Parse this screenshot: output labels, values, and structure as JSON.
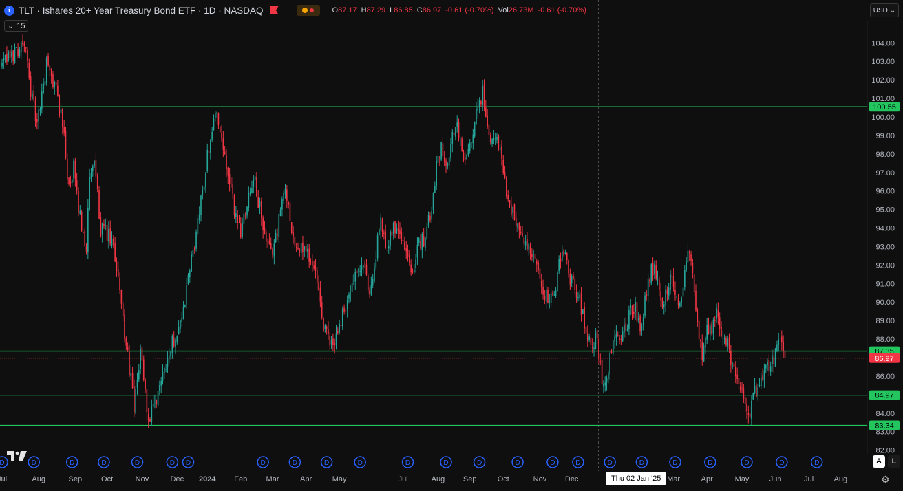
{
  "header": {
    "info_glyph": "i",
    "title": "TLT · Ishares 20+ Year Treasury Bond ETF · 1D · NASDAQ",
    "ohlc": [
      {
        "k": "O",
        "v": "87.17"
      },
      {
        "k": "H",
        "v": "87.29"
      },
      {
        "k": "L",
        "v": "86.85"
      },
      {
        "k": "C",
        "v": "86.97"
      },
      {
        "k": "",
        "v": "-0.61 (-0.70%)"
      },
      {
        "k": "Vol",
        "v": "26.73M"
      },
      {
        "k": "",
        "v": "-0.61 (-0.70%)"
      }
    ],
    "interval_label": "15",
    "currency": "USD"
  },
  "colors": {
    "background": "#0f0f0f",
    "up": "#26a69a",
    "down": "#f23645",
    "level_line": "#22c55e",
    "current_line": "#f23645",
    "dividend_badge": "#2962ff"
  },
  "controls": {
    "auto_label": "A",
    "log_label": "L"
  },
  "crosshair": {
    "date_label": "Thu 02 Jan '25"
  },
  "dividend_label": "D",
  "chart_data": {
    "type": "candlestick",
    "title": "TLT · Ishares 20+ Year Treasury Bond ETF · 1D · NASDAQ",
    "ylim": [
      81.8,
      105.2
    ],
    "y_ticks": [
      82,
      83,
      84,
      85,
      86,
      87,
      88,
      89,
      90,
      91,
      92,
      93,
      94,
      95,
      96,
      97,
      98,
      99,
      100,
      101,
      102,
      103,
      104
    ],
    "y_tick_labels": [
      "82.00",
      "83.00",
      "84.00",
      "85.00",
      "86.00",
      "87.00",
      "88.00",
      "89.00",
      "90.00",
      "91.00",
      "92.00",
      "93.00",
      "94.00",
      "95.00",
      "96.00",
      "97.00",
      "98.00",
      "99.00",
      "100.00",
      "101.00",
      "102.00",
      "103.00",
      "104.00"
    ],
    "x_labels": [
      "Jul",
      "Aug",
      "Sep",
      "Oct",
      "Nov",
      "Dec",
      "2024",
      "Feb",
      "Mar",
      "Apr",
      "May",
      "Jul",
      "Aug",
      "Sep",
      "Oct",
      "Nov",
      "Dec",
      "Mar",
      "Apr",
      "May",
      "Jun",
      "Jul",
      "Aug"
    ],
    "x_label_index": [
      0,
      23,
      46,
      66,
      88,
      110,
      129,
      150,
      170,
      191,
      212,
      252,
      274,
      294,
      315,
      338,
      358,
      422,
      443,
      465,
      486,
      507,
      527
    ],
    "total_bars": 545,
    "price_line": {
      "value": 86.97,
      "label": "86.97"
    },
    "horizontal_levels": [
      {
        "value": 100.55,
        "label": "100.55"
      },
      {
        "value": 87.35,
        "label": "87.35"
      },
      {
        "value": 84.97,
        "label": "84.97"
      },
      {
        "value": 83.34,
        "label": "83.34"
      }
    ],
    "crosshair_index": 375,
    "dividend_index": [
      0,
      20,
      44,
      64,
      85,
      107,
      117,
      164,
      184,
      204,
      225,
      255,
      279,
      300,
      324,
      346,
      362,
      382,
      402,
      423,
      445,
      468,
      490,
      512
    ],
    "price_path": [
      [
        0,
        102.8
      ],
      [
        8,
        103.5
      ],
      [
        14,
        104
      ],
      [
        18,
        101.5
      ],
      [
        22,
        99.5
      ],
      [
        28,
        102.8
      ],
      [
        34,
        101.5
      ],
      [
        39,
        99
      ],
      [
        42,
        96
      ],
      [
        45,
        97.2
      ],
      [
        48,
        95
      ],
      [
        53,
        93
      ],
      [
        55,
        96.5
      ],
      [
        58,
        97.5
      ],
      [
        62,
        94
      ],
      [
        67,
        93.5
      ],
      [
        70,
        92.8
      ],
      [
        74,
        91
      ],
      [
        77,
        88
      ],
      [
        81,
        86
      ],
      [
        83,
        84
      ],
      [
        87,
        87.5
      ],
      [
        92,
        83.5
      ],
      [
        97,
        84.5
      ],
      [
        100,
        86
      ],
      [
        108,
        88
      ],
      [
        114,
        89.5
      ],
      [
        118,
        91.8
      ],
      [
        122,
        93.6
      ],
      [
        126,
        96
      ],
      [
        130,
        98.5
      ],
      [
        133,
        99.8
      ],
      [
        135,
        100.5
      ],
      [
        138,
        98.5
      ],
      [
        142,
        96.8
      ],
      [
        146,
        95
      ],
      [
        150,
        93.8
      ],
      [
        154,
        95.5
      ],
      [
        158,
        96.8
      ],
      [
        162,
        95
      ],
      [
        165,
        93.5
      ],
      [
        169,
        92.5
      ],
      [
        173,
        94
      ],
      [
        178,
        96.2
      ],
      [
        181,
        94.6
      ],
      [
        185,
        92.6
      ],
      [
        189,
        93
      ],
      [
        193,
        92.5
      ],
      [
        197,
        91.5
      ],
      [
        201,
        89
      ],
      [
        205,
        88
      ],
      [
        208,
        87.6
      ],
      [
        211,
        88.5
      ],
      [
        215,
        89.6
      ],
      [
        219,
        90.5
      ],
      [
        223,
        91.5
      ],
      [
        227,
        92
      ],
      [
        231,
        90.5
      ],
      [
        235,
        92.5
      ],
      [
        238,
        94.5
      ],
      [
        241,
        93
      ],
      [
        245,
        94
      ],
      [
        250,
        94
      ],
      [
        254,
        92.6
      ],
      [
        258,
        91.8
      ],
      [
        262,
        93
      ],
      [
        266,
        93.6
      ],
      [
        270,
        95
      ],
      [
        273,
        97.5
      ],
      [
        276,
        98.5
      ],
      [
        280,
        97.5
      ],
      [
        283,
        98.8
      ],
      [
        286,
        99.6
      ],
      [
        290,
        97.5
      ],
      [
        293,
        98
      ],
      [
        296,
        99
      ],
      [
        299,
        100.5
      ],
      [
        302,
        101.3
      ],
      [
        305,
        99.6
      ],
      [
        308,
        98.5
      ],
      [
        311,
        99
      ],
      [
        314,
        97.8
      ],
      [
        317,
        96
      ],
      [
        320,
        95
      ],
      [
        323,
        94.5
      ],
      [
        326,
        93.8
      ],
      [
        329,
        93
      ],
      [
        333,
        92.5
      ],
      [
        337,
        91.5
      ],
      [
        341,
        90.5
      ],
      [
        344,
        90
      ],
      [
        348,
        91
      ],
      [
        352,
        93
      ],
      [
        355,
        92
      ],
      [
        358,
        91
      ],
      [
        362,
        90.5
      ],
      [
        366,
        89
      ],
      [
        370,
        87.5
      ],
      [
        373,
        88
      ],
      [
        376,
        86.8
      ],
      [
        378,
        85.2
      ],
      [
        381,
        86.5
      ],
      [
        384,
        87.8
      ],
      [
        388,
        88
      ],
      [
        392,
        88.5
      ],
      [
        395,
        89.6
      ],
      [
        398,
        89.8
      ],
      [
        401,
        88.5
      ],
      [
        405,
        90.5
      ],
      [
        408,
        92
      ],
      [
        411,
        91.5
      ],
      [
        414,
        90
      ],
      [
        418,
        90.5
      ],
      [
        421,
        91.5
      ],
      [
        424,
        90.2
      ],
      [
        426,
        89.5
      ],
      [
        429,
        92
      ],
      [
        431,
        93.2
      ],
      [
        434,
        91.5
      ],
      [
        437,
        89
      ],
      [
        440,
        87
      ],
      [
        443,
        88.5
      ],
      [
        446,
        88.2
      ],
      [
        449,
        89.8
      ],
      [
        452,
        88.6
      ],
      [
        455,
        88
      ],
      [
        458,
        87
      ],
      [
        461,
        86.2
      ],
      [
        464,
        85.5
      ],
      [
        467,
        84.5
      ],
      [
        469,
        83.6
      ],
      [
        472,
        84.8
      ],
      [
        475,
        85.5
      ],
      [
        479,
        86
      ],
      [
        482,
        86.5
      ],
      [
        485,
        87
      ],
      [
        488,
        88.2
      ],
      [
        490,
        87.4
      ],
      [
        492,
        86.97
      ]
    ]
  }
}
